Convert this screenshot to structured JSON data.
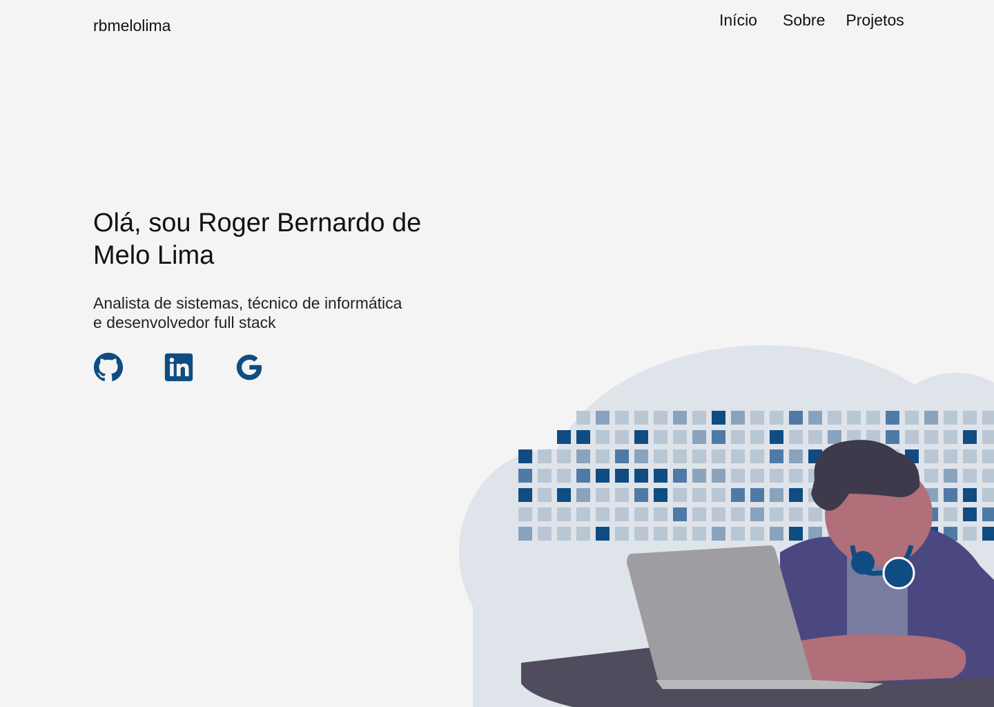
{
  "brand": "rbmelolima",
  "nav": {
    "items": [
      "Início",
      "Sobre",
      "Projetos"
    ]
  },
  "hero": {
    "title": "Olá, sou Roger Bernardo de Melo Lima",
    "subtitle_line1": "Analista de sistemas, técnico de informática",
    "subtitle_line2": "e desenvolvedor full stack"
  },
  "socials": [
    {
      "icon": "github-icon"
    },
    {
      "icon": "linkedin-icon"
    },
    {
      "icon": "google-icon"
    }
  ],
  "colors": {
    "background": "#f4f4f4",
    "accent": "#0f4c81",
    "text": "#111111",
    "cloud": "#dfe3ea"
  }
}
